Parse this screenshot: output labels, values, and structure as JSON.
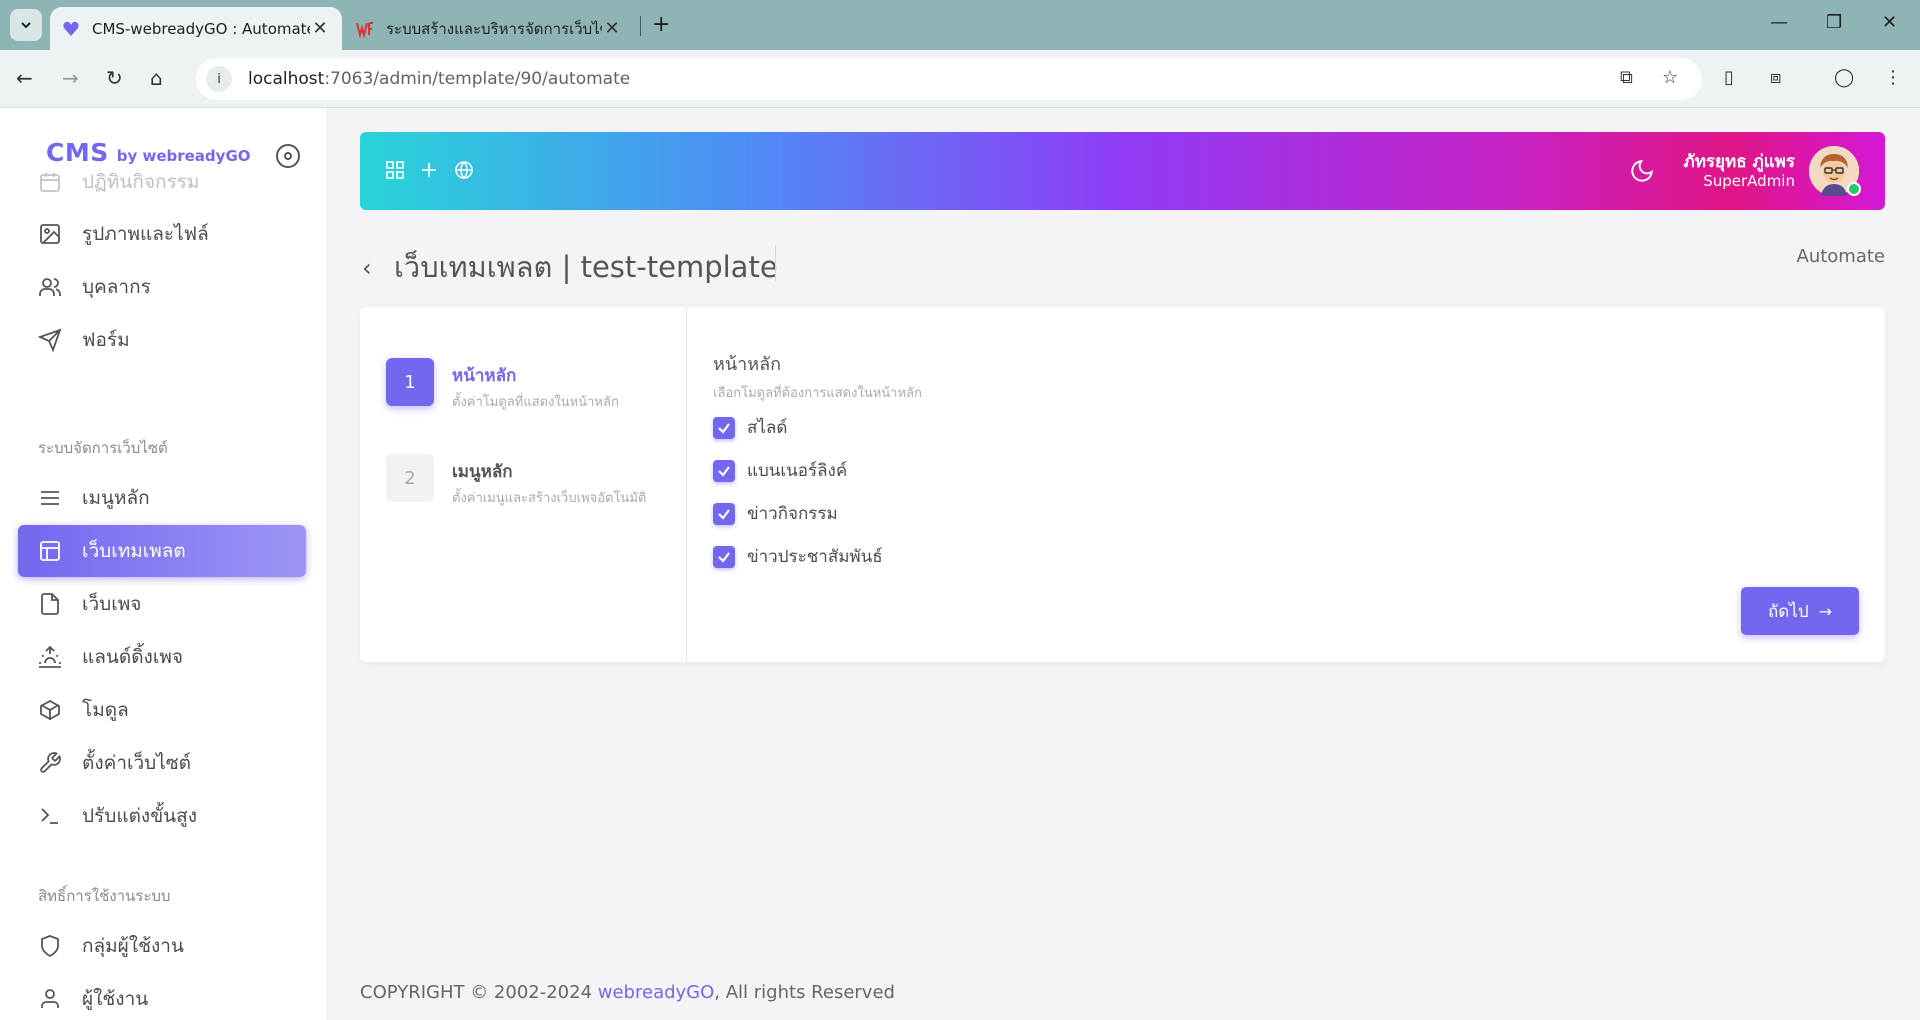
{
  "browser": {
    "tabs": [
      {
        "title": "CMS-webreadyGO : Automate",
        "active": true
      },
      {
        "title": "ระบบสร้างและบริหารจัดการเว็บไซต์",
        "active": false
      }
    ],
    "url_host": "localhost",
    "url_rest": ":7063/admin/template/90/automate"
  },
  "brand": {
    "name": "CMS",
    "by": "by webreadyGO",
    "color": "#7367f0"
  },
  "sidebar": {
    "items_top": [
      {
        "label": "ปฏิทินกิจกรรม",
        "icon": "calendar-icon"
      },
      {
        "label": "รูปภาพและไฟล์",
        "icon": "image-icon"
      },
      {
        "label": "บุคลากร",
        "icon": "users-icon"
      },
      {
        "label": "ฟอร์ม",
        "icon": "send-icon"
      }
    ],
    "section_web": "ระบบจัดการเว็บไซต์",
    "items_web": [
      {
        "label": "เมนูหลัก",
        "icon": "menu-icon"
      },
      {
        "label": "เว็บเทมเพลต",
        "icon": "layout-icon",
        "active": true
      },
      {
        "label": "เว็บเพจ",
        "icon": "file-icon"
      },
      {
        "label": "แลนด์ดิ้งเพจ",
        "icon": "sunrise-icon"
      },
      {
        "label": "โมดูล",
        "icon": "box-icon"
      },
      {
        "label": "ตั้งค่าเว็บไซต์",
        "icon": "tool-icon"
      },
      {
        "label": "ปรับแต่งขั้นสูง",
        "icon": "terminal-icon"
      }
    ],
    "section_perm": "สิทธิ์การใช้งานระบบ",
    "items_perm": [
      {
        "label": "กลุ่มผู้ใช้งาน",
        "icon": "shield-icon"
      },
      {
        "label": "ผู้ใช้งาน",
        "icon": "user-icon"
      }
    ]
  },
  "user": {
    "name": "ภัทรยุทธ ภู่แพร",
    "role": "SuperAdmin",
    "status_color": "#28c76f"
  },
  "page": {
    "title": "เว็บเทมเพลต | test-template",
    "breadcrumb": "Automate"
  },
  "wizard": {
    "steps": [
      {
        "num": "1",
        "title": "หน้าหลัก",
        "desc": "ตั้งค่าโมดูลที่แสดงในหน้าหลัก"
      },
      {
        "num": "2",
        "title": "เมนูหลัก",
        "desc": "ตั้งค่าเมนูและสร้างเว็บเพจอัตโนมัติ"
      }
    ],
    "content_title": "หน้าหลัก",
    "content_desc": "เลือกโมดูลที่ต้องการแสดงในหน้าหลัก",
    "options": [
      {
        "label": "สไลด์",
        "checked": true
      },
      {
        "label": "แบนเนอร์ลิงค์",
        "checked": true
      },
      {
        "label": "ข่าวกิจกรรม",
        "checked": true
      },
      {
        "label": "ข่าวประชาสัมพันธ์",
        "checked": true
      }
    ],
    "next_label": "ถัดไป"
  },
  "footer": {
    "prefix": "COPYRIGHT © 2002-2024 ",
    "brand": "webreadyGO",
    "suffix": ", All rights Reserved"
  }
}
